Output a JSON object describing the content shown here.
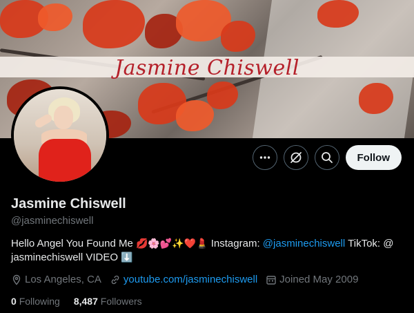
{
  "banner": {
    "script_name": "Jasmine Chiswell"
  },
  "actions": {
    "follow_label": "Follow"
  },
  "profile": {
    "display_name": "Jasmine Chiswell",
    "handle": "@jasminechiswell",
    "bio": {
      "lead": "Hello Angel You Found Me",
      "emojis": "💋🌸💕✨❤️💄",
      "instagram_label": "Instagram:",
      "instagram_link": "@jasminechiswell",
      "tiktok_label": "TikTok:",
      "tiktok_handle": "@ jasminechiswell",
      "video_label": "VIDEO",
      "video_emoji": "⬇️"
    },
    "location": "Los Angeles, CA",
    "website": "youtube.com/jasminechiswell",
    "joined": "Joined May 2009",
    "following_count": "0",
    "following_label": "Following",
    "followers_count": "8,487",
    "followers_label": "Followers"
  },
  "colors": {
    "accent": "#1d9bf0",
    "background": "#000000",
    "name_script": "#b5202a"
  },
  "icons": [
    "more-icon",
    "grok-icon",
    "search-icon",
    "location-icon",
    "link-icon",
    "calendar-icon"
  ]
}
